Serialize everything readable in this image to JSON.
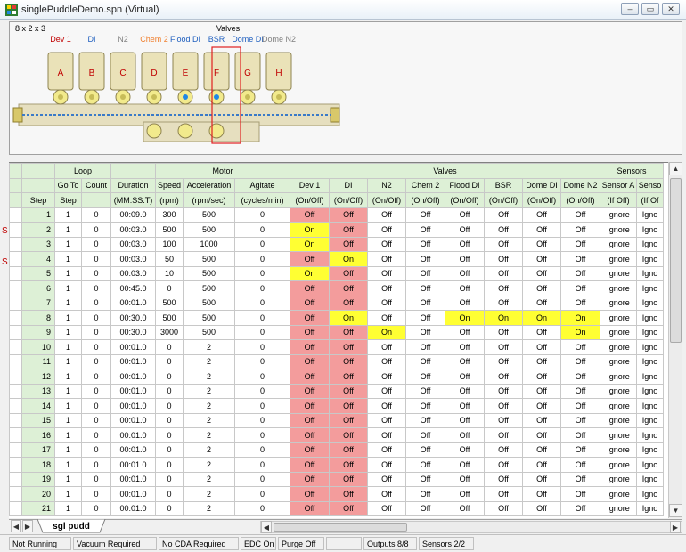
{
  "window": {
    "title": "singlePuddleDemo.spn (Virtual)",
    "minimize_glyph": "–",
    "restore_glyph": "▭",
    "close_glyph": "✕"
  },
  "manifold": {
    "size_label": "8 x 2 x 3",
    "valves_title": "Valves",
    "valve_names": [
      {
        "name": "Dev 1",
        "color": "#c00000"
      },
      {
        "name": "DI",
        "color": "#1f5fbf"
      },
      {
        "name": "N2",
        "color": "#808080"
      },
      {
        "name": "Chem 2",
        "color": "#f08030"
      },
      {
        "name": "Flood DI",
        "color": "#1f5fbf"
      },
      {
        "name": "BSR",
        "color": "#1f5fbf"
      },
      {
        "name": "Dome DI",
        "color": "#1f5fbf"
      },
      {
        "name": "Dome N2",
        "color": "#808080"
      }
    ],
    "valve_letters": [
      "A",
      "B",
      "C",
      "D",
      "E",
      "F",
      "G",
      "H"
    ]
  },
  "grid": {
    "group_headers": {
      "loop": "Loop",
      "motor": "Motor",
      "valves": "Valves",
      "sensors": "Sensors"
    },
    "columns": [
      {
        "h1": "",
        "h2": "Step"
      },
      {
        "h1": "Go To",
        "h2": "Step"
      },
      {
        "h1": "Count",
        "h2": ""
      },
      {
        "h1": "Duration",
        "h2": "(MM:SS.T)"
      },
      {
        "h1": "Speed",
        "h2": "(rpm)"
      },
      {
        "h1": "Acceleration",
        "h2": "(rpm/sec)"
      },
      {
        "h1": "Agitate",
        "h2": "(cycles/min)"
      },
      {
        "h1": "Dev 1",
        "h2": "(On/Off)"
      },
      {
        "h1": "DI",
        "h2": "(On/Off)"
      },
      {
        "h1": "N2",
        "h2": "(On/Off)"
      },
      {
        "h1": "Chem 2",
        "h2": "(On/Off)"
      },
      {
        "h1": "Flood DI",
        "h2": "(On/Off)"
      },
      {
        "h1": "BSR",
        "h2": "(On/Off)"
      },
      {
        "h1": "Dome DI",
        "h2": "(On/Off)"
      },
      {
        "h1": "Dome N2",
        "h2": "(On/Off)"
      },
      {
        "h1": "Sensor A",
        "h2": "(If Off)"
      },
      {
        "h1": "Senso",
        "h2": "(If Of"
      }
    ],
    "rows": [
      [
        "1",
        "1",
        "0",
        "00:09.0",
        "300",
        "500",
        "0",
        "Off",
        "Off",
        "Off",
        "Off",
        "Off",
        "Off",
        "Off",
        "Off",
        "Ignore",
        "Igno"
      ],
      [
        "2",
        "1",
        "0",
        "00:03.0",
        "500",
        "500",
        "0",
        "On",
        "Off",
        "Off",
        "Off",
        "Off",
        "Off",
        "Off",
        "Off",
        "Ignore",
        "Igno"
      ],
      [
        "3",
        "1",
        "0",
        "00:03.0",
        "100",
        "1000",
        "0",
        "On",
        "Off",
        "Off",
        "Off",
        "Off",
        "Off",
        "Off",
        "Off",
        "Ignore",
        "Igno"
      ],
      [
        "4",
        "1",
        "0",
        "00:03.0",
        "50",
        "500",
        "0",
        "Off",
        "On",
        "Off",
        "Off",
        "Off",
        "Off",
        "Off",
        "Off",
        "Ignore",
        "Igno"
      ],
      [
        "5",
        "1",
        "0",
        "00:03.0",
        "10",
        "500",
        "0",
        "On",
        "Off",
        "Off",
        "Off",
        "Off",
        "Off",
        "Off",
        "Off",
        "Ignore",
        "Igno"
      ],
      [
        "6",
        "1",
        "0",
        "00:45.0",
        "0",
        "500",
        "0",
        "Off",
        "Off",
        "Off",
        "Off",
        "Off",
        "Off",
        "Off",
        "Off",
        "Ignore",
        "Igno"
      ],
      [
        "7",
        "1",
        "0",
        "00:01.0",
        "500",
        "500",
        "0",
        "Off",
        "Off",
        "Off",
        "Off",
        "Off",
        "Off",
        "Off",
        "Off",
        "Ignore",
        "Igno"
      ],
      [
        "8",
        "1",
        "0",
        "00:30.0",
        "500",
        "500",
        "0",
        "Off",
        "On",
        "Off",
        "Off",
        "On",
        "On",
        "On",
        "On",
        "Ignore",
        "Igno"
      ],
      [
        "9",
        "1",
        "0",
        "00:30.0",
        "3000",
        "500",
        "0",
        "Off",
        "Off",
        "On",
        "Off",
        "Off",
        "Off",
        "Off",
        "On",
        "Ignore",
        "Igno"
      ],
      [
        "10",
        "1",
        "0",
        "00:01.0",
        "0",
        "2",
        "0",
        "Off",
        "Off",
        "Off",
        "Off",
        "Off",
        "Off",
        "Off",
        "Off",
        "Ignore",
        "Igno"
      ],
      [
        "11",
        "1",
        "0",
        "00:01.0",
        "0",
        "2",
        "0",
        "Off",
        "Off",
        "Off",
        "Off",
        "Off",
        "Off",
        "Off",
        "Off",
        "Ignore",
        "Igno"
      ],
      [
        "12",
        "1",
        "0",
        "00:01.0",
        "0",
        "2",
        "0",
        "Off",
        "Off",
        "Off",
        "Off",
        "Off",
        "Off",
        "Off",
        "Off",
        "Ignore",
        "Igno"
      ],
      [
        "13",
        "1",
        "0",
        "00:01.0",
        "0",
        "2",
        "0",
        "Off",
        "Off",
        "Off",
        "Off",
        "Off",
        "Off",
        "Off",
        "Off",
        "Ignore",
        "Igno"
      ],
      [
        "14",
        "1",
        "0",
        "00:01.0",
        "0",
        "2",
        "0",
        "Off",
        "Off",
        "Off",
        "Off",
        "Off",
        "Off",
        "Off",
        "Off",
        "Ignore",
        "Igno"
      ],
      [
        "15",
        "1",
        "0",
        "00:01.0",
        "0",
        "2",
        "0",
        "Off",
        "Off",
        "Off",
        "Off",
        "Off",
        "Off",
        "Off",
        "Off",
        "Ignore",
        "Igno"
      ],
      [
        "16",
        "1",
        "0",
        "00:01.0",
        "0",
        "2",
        "0",
        "Off",
        "Off",
        "Off",
        "Off",
        "Off",
        "Off",
        "Off",
        "Off",
        "Ignore",
        "Igno"
      ],
      [
        "17",
        "1",
        "0",
        "00:01.0",
        "0",
        "2",
        "0",
        "Off",
        "Off",
        "Off",
        "Off",
        "Off",
        "Off",
        "Off",
        "Off",
        "Ignore",
        "Igno"
      ],
      [
        "18",
        "1",
        "0",
        "00:01.0",
        "0",
        "2",
        "0",
        "Off",
        "Off",
        "Off",
        "Off",
        "Off",
        "Off",
        "Off",
        "Off",
        "Ignore",
        "Igno"
      ],
      [
        "19",
        "1",
        "0",
        "00:01.0",
        "0",
        "2",
        "0",
        "Off",
        "Off",
        "Off",
        "Off",
        "Off",
        "Off",
        "Off",
        "Off",
        "Ignore",
        "Igno"
      ],
      [
        "20",
        "1",
        "0",
        "00:01.0",
        "0",
        "2",
        "0",
        "Off",
        "Off",
        "Off",
        "Off",
        "Off",
        "Off",
        "Off",
        "Off",
        "Ignore",
        "Igno"
      ],
      [
        "21",
        "1",
        "0",
        "00:01.0",
        "0",
        "2",
        "0",
        "Off",
        "Off",
        "Off",
        "Off",
        "Off",
        "Off",
        "Off",
        "Off",
        "Ignore",
        "Igno"
      ]
    ],
    "row_markers": [
      {
        "step": "2",
        "text": "S"
      },
      {
        "step": "4",
        "text": "S"
      }
    ],
    "colors": {
      "header_bg": "#ddf0d6",
      "dev1_column": "#f39c9c",
      "di_column": "#f39c9c",
      "on_highlight": "#ffff33"
    }
  },
  "tabs": {
    "nav_glyphs": [
      "◀",
      "▶"
    ],
    "active_tab": "sgl pudd"
  },
  "scroll": {
    "up_glyph": "▲",
    "down_glyph": "▼",
    "left_glyph": "◀",
    "right_glyph": "▶"
  },
  "status": [
    "Not Running",
    "Vacuum Required",
    "No CDA Required",
    "EDC On",
    "Purge Off",
    "",
    "Outputs 8/8",
    "Sensors 2/2"
  ]
}
